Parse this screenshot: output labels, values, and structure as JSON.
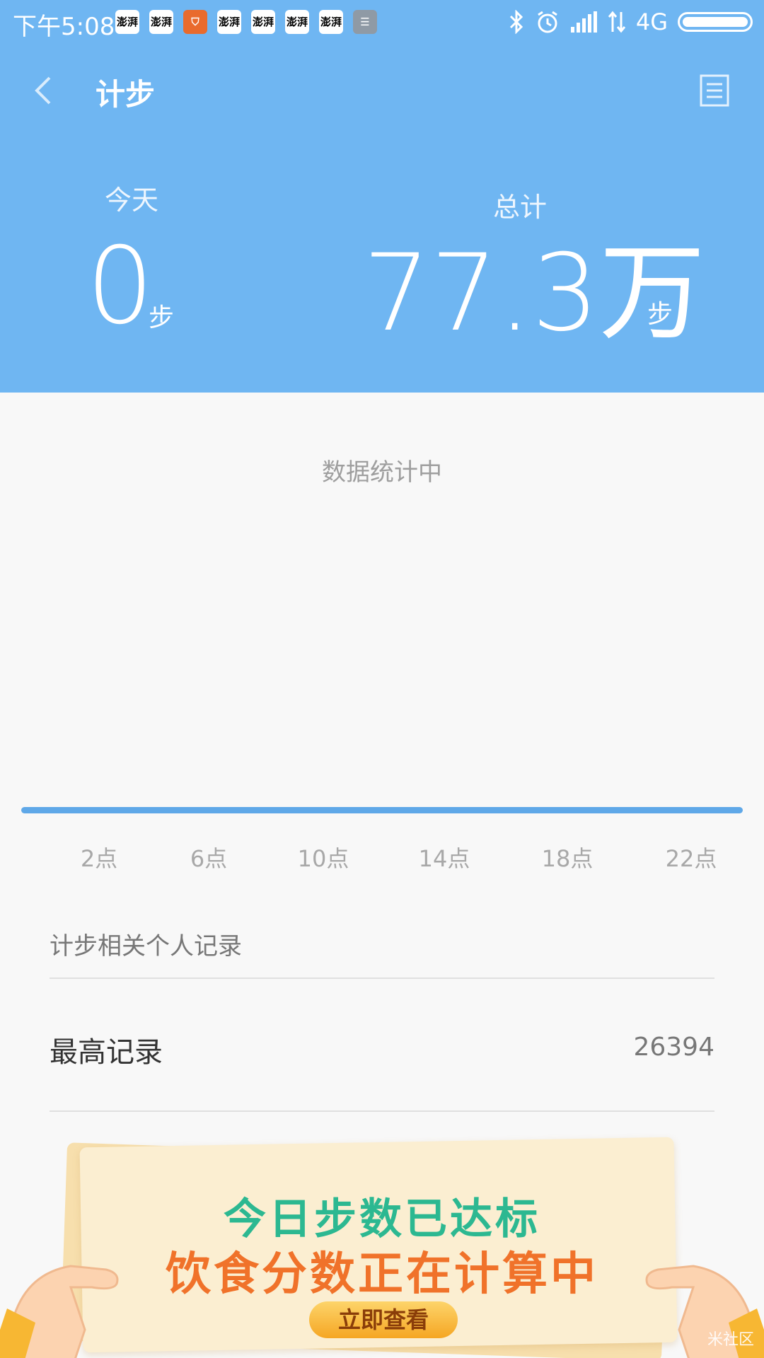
{
  "status_bar": {
    "time": "下午5:08",
    "notification_icons": [
      "澎湃",
      "澎湃",
      "shield-app",
      "澎湃",
      "澎湃",
      "澎湃",
      "澎湃",
      "message-app"
    ],
    "network": "4G"
  },
  "header": {
    "title": "计步",
    "today_label": "今天",
    "today_value": "0",
    "today_unit": "步",
    "total_label": "总计",
    "total_value": "77.3万",
    "total_unit": "步"
  },
  "chart": {
    "status_text": "数据统计中",
    "ticks": [
      "2点",
      "6点",
      "10点",
      "14点",
      "18点",
      "22点"
    ]
  },
  "records": {
    "section_title": "计步相关个人记录",
    "best_label": "最高记录",
    "best_value": "26394"
  },
  "banner": {
    "line1": "今日步数已达标",
    "line2": "饮食分数正在计算中",
    "button": "立即查看",
    "watermark": "米社区"
  },
  "colors": {
    "header_bg": "#6fb6f2",
    "chart_line": "#5fa8e8",
    "banner_green": "#2cb891",
    "banner_orange": "#f0722a"
  }
}
